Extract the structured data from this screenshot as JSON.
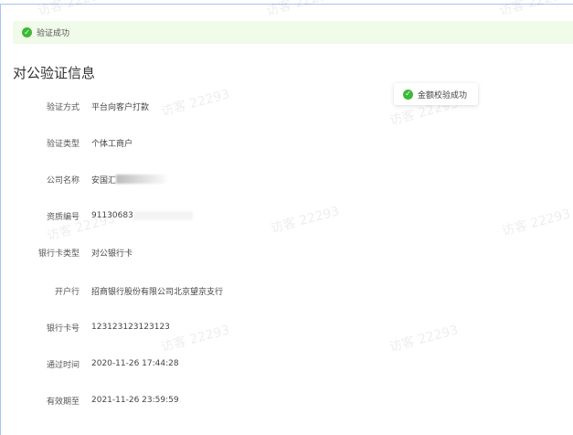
{
  "alert": {
    "text": "验证成功",
    "icon": "check-circle-icon",
    "color": "#3cb935"
  },
  "title": "对公验证信息",
  "toast": {
    "text": "金额校验成功",
    "icon": "check-circle-icon"
  },
  "watermark": "访客 22293",
  "fields": [
    {
      "label": "验证方式",
      "value": "平台向客户打款"
    },
    {
      "label": "验证类型",
      "value": "个体工商户"
    },
    {
      "label": "公司名称",
      "value": "安国汇"
    },
    {
      "label": "资质编号",
      "value": "91130683"
    },
    {
      "label": "银行卡类型",
      "value": "对公银行卡"
    },
    {
      "label": "开户行",
      "value": "招商银行股份有限公司北京望京支行"
    },
    {
      "label": "银行卡号",
      "value": "123123123123123"
    },
    {
      "label": "通过时间",
      "value": "2020-11-26 17:44:28"
    },
    {
      "label": "有效期至",
      "value": "2021-11-26 23:59:59"
    }
  ]
}
